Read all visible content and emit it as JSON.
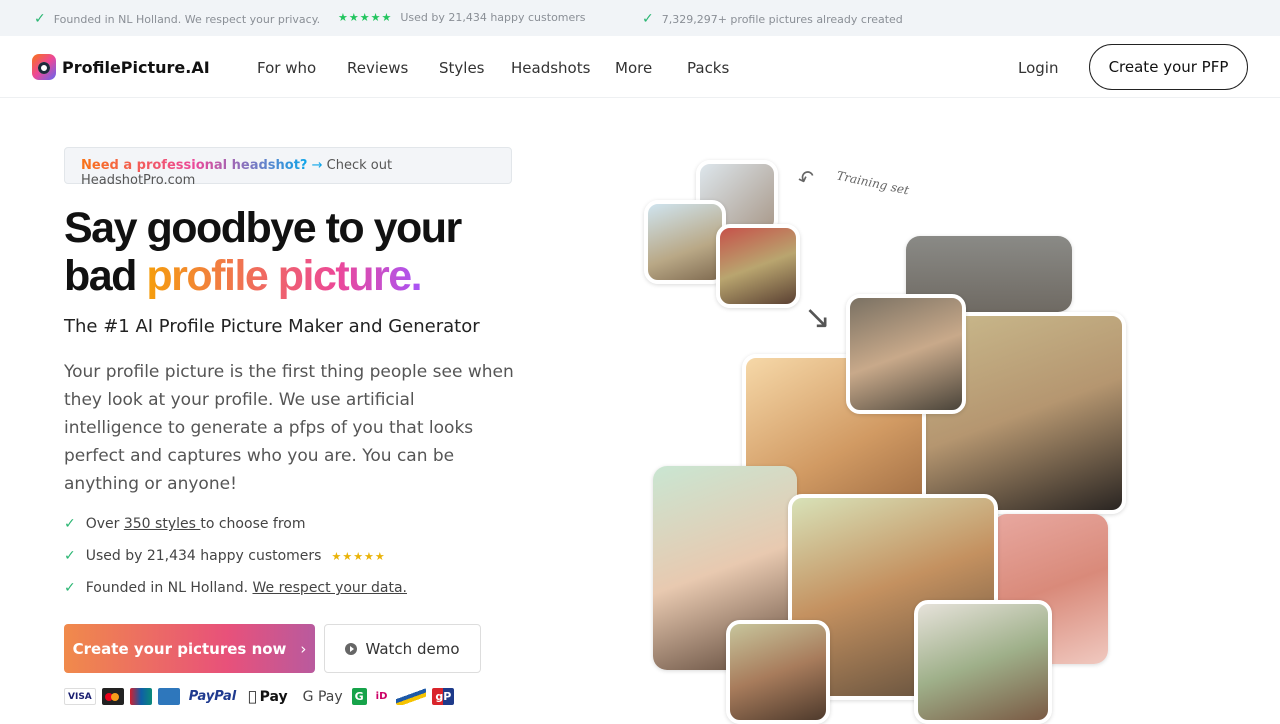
{
  "topbar": {
    "founded": "Founded in NL Holland. We respect your privacy.",
    "used": "Used by 21,434 happy customers",
    "created": "7,329,297+ profile pictures already created",
    "stars": "★★★★★"
  },
  "nav": {
    "brand": "ProfilePicture.AI",
    "links": [
      "For who",
      "Reviews",
      "Styles",
      "Headshots",
      "More",
      "Packs"
    ],
    "login": "Login",
    "cta": "Create your PFP"
  },
  "promo": {
    "highlight": "Need a professional headshot?",
    "arrow": "→",
    "text": "Check out HeadshotPro.com"
  },
  "hero": {
    "title_line1": "Say goodbye to your",
    "title_bad": "bad ",
    "title_grad": "profile picture.",
    "subtitle": "The #1 AI Profile Picture Maker and Generator",
    "description": "Your profile picture is the first thing people see when they look at your profile. We use artificial intelligence to generate a pfps of you that looks perfect and captures who you are. You can be anything or anyone!"
  },
  "features": [
    {
      "pre": "Over ",
      "link": "350 styles ",
      "post": "to choose from"
    },
    {
      "pre": "Used by 21,434 happy customers",
      "stars": "★★★★★"
    },
    {
      "pre": "Founded in NL Holland. ",
      "link": "We respect your data."
    }
  ],
  "buttons": {
    "primary": "Create your pictures now",
    "primary_chevron": "›",
    "demo": "Watch demo"
  },
  "payments": [
    "VISA",
    "Mastercard",
    "UnionPay",
    "AMEX",
    "PayPal",
    "Pay",
    "G Pay",
    "G",
    "iD",
    "Bancontact",
    "gP"
  ],
  "illustration": {
    "note": "Training set"
  },
  "colors": {
    "check": "#2bb673",
    "accent_start": "#f08a4b",
    "accent_end": "#b95a9e"
  }
}
